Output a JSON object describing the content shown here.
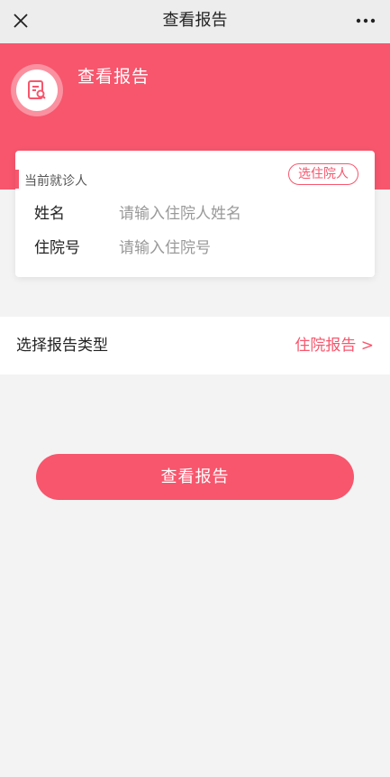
{
  "topbar": {
    "title": "查看报告",
    "close_icon": "close-icon",
    "more_icon": "more-icon"
  },
  "hero": {
    "title": "查看报告",
    "icon": "report-search-icon",
    "background": "#f7566d"
  },
  "patient_card": {
    "label": "当前就诊人",
    "select_button": "选住院人",
    "fields": [
      {
        "label": "姓名",
        "placeholder": "请输入住院人姓名",
        "value": ""
      },
      {
        "label": "住院号",
        "placeholder": "请输入住院号",
        "value": ""
      }
    ]
  },
  "report_type": {
    "label": "选择报告类型",
    "value": "住院报告 >"
  },
  "submit": {
    "label": "查看报告"
  },
  "colors": {
    "accent": "#f7566d",
    "page_background": "#f3f3f3",
    "topbar_background": "#ededed"
  }
}
